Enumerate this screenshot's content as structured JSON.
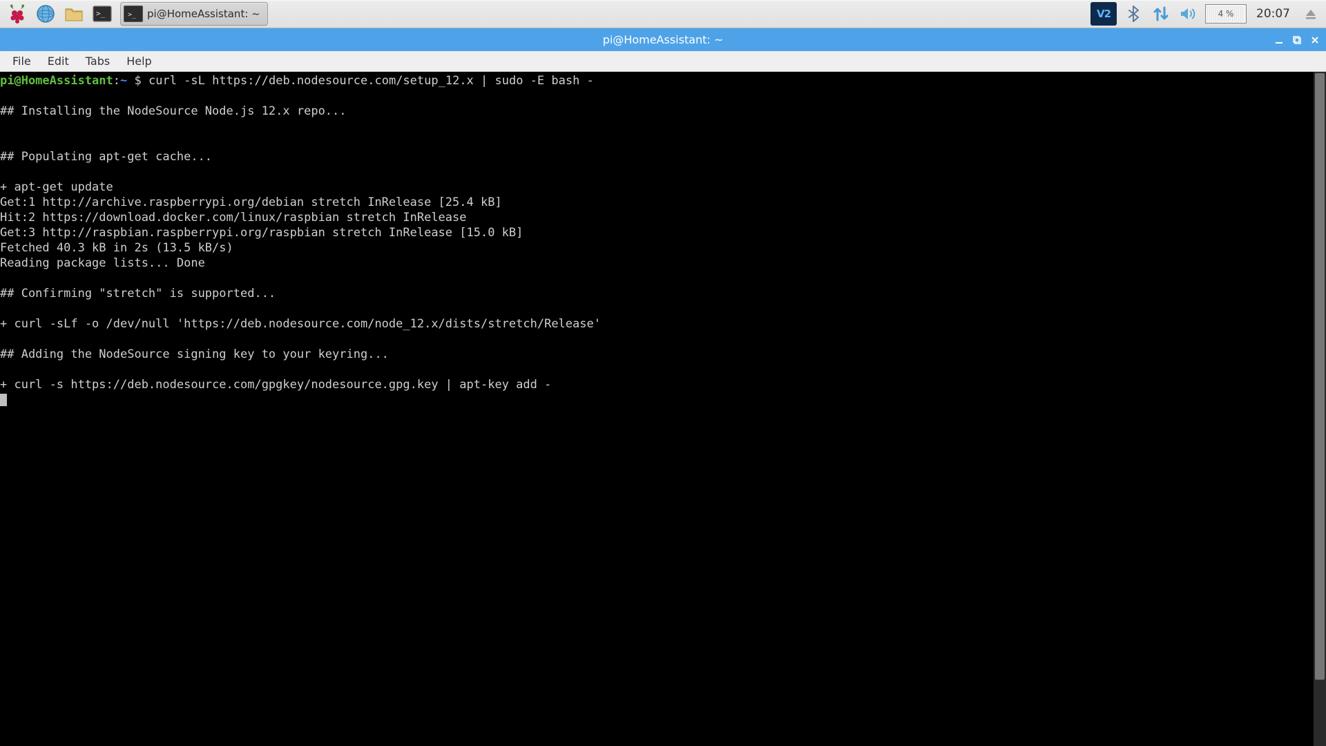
{
  "taskbar": {
    "task_button_label": "pi@HomeAssistant: ~",
    "cpu_percent": "4 %",
    "clock": "20:07",
    "vnc_label": "V2"
  },
  "window": {
    "title": "pi@HomeAssistant: ~"
  },
  "menus": {
    "file": "File",
    "edit": "Edit",
    "tabs": "Tabs",
    "help": "Help"
  },
  "prompt": {
    "user_host": "pi@HomeAssistant",
    "colon": ":",
    "path": "~",
    "dollar": " $ ",
    "command": "curl -sL https://deb.nodesource.com/setup_12.x | sudo -E bash -"
  },
  "terminal_lines": [
    "",
    "## Installing the NodeSource Node.js 12.x repo...",
    "",
    "",
    "## Populating apt-get cache...",
    "",
    "+ apt-get update",
    "Get:1 http://archive.raspberrypi.org/debian stretch InRelease [25.4 kB]",
    "Hit:2 https://download.docker.com/linux/raspbian stretch InRelease",
    "Get:3 http://raspbian.raspberrypi.org/raspbian stretch InRelease [15.0 kB]",
    "Fetched 40.3 kB in 2s (13.5 kB/s)",
    "Reading package lists... Done",
    "",
    "## Confirming \"stretch\" is supported...",
    "",
    "+ curl -sLf -o /dev/null 'https://deb.nodesource.com/node_12.x/dists/stretch/Release'",
    "",
    "## Adding the NodeSource signing key to your keyring...",
    "",
    "+ curl -s https://deb.nodesource.com/gpgkey/nodesource.gpg.key | apt-key add -"
  ]
}
